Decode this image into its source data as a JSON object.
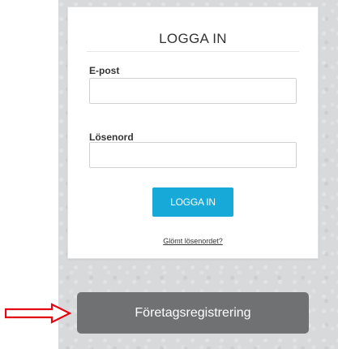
{
  "login": {
    "title": "LOGGA IN",
    "email_label": "E-post",
    "email_value": "",
    "password_label": "Lösenord",
    "password_value": "",
    "submit_label": "LOGGA IN",
    "forgot_link": "Glömt lösenordet?"
  },
  "register": {
    "button_label": "Företagsregistrering"
  },
  "annotation": {
    "arrow_icon": "right-arrow-outline-icon",
    "arrow_color": "#e30613"
  },
  "colors": {
    "panel_background": "#d7d9db",
    "primary_button": "#17a9d8",
    "register_button": "#707172"
  }
}
